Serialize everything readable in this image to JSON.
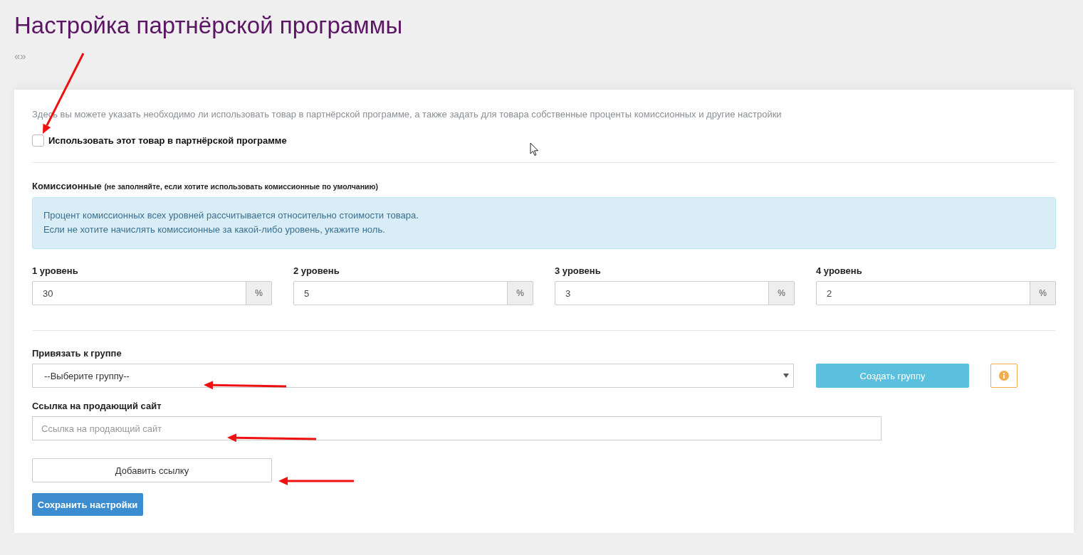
{
  "page": {
    "title": "Настройка партнёрской программы",
    "breadcrumb": "«»"
  },
  "intro": "Здесь вы можете указать необходимо ли использовать товар в партнёрской программе, а также задать для товара собственные проценты комиссионных и другие настройки",
  "use_checkbox": {
    "label": "Использовать этот товар в партнёрской программе",
    "checked": false
  },
  "commission": {
    "label": "Комиссионные",
    "hint": "(не заполняйте, если хотите использовать комиссионные по умолчанию)",
    "alert": [
      "Процент комиссионных всех уровней рассчитывается относительно стоимости товара.",
      "Если не хотите начислять комиссионные за какой-либо уровень, укажите ноль."
    ],
    "levels": [
      {
        "label": "1 уровень",
        "value": "30",
        "suffix": "%"
      },
      {
        "label": "2 уровень",
        "value": "5",
        "suffix": "%"
      },
      {
        "label": "3 уровень",
        "value": "3",
        "suffix": "%"
      },
      {
        "label": "4 уровень",
        "value": "2",
        "suffix": "%"
      }
    ]
  },
  "group": {
    "label": "Привязать к группе",
    "select_value": "--Выберите группу--",
    "create_button": "Создать группу"
  },
  "link": {
    "label": "Ссылка на продающий сайт",
    "placeholder": "Ссылка на продающий сайт",
    "add_button": "Добавить ссылку"
  },
  "save_button": "Сохранить настройки"
}
